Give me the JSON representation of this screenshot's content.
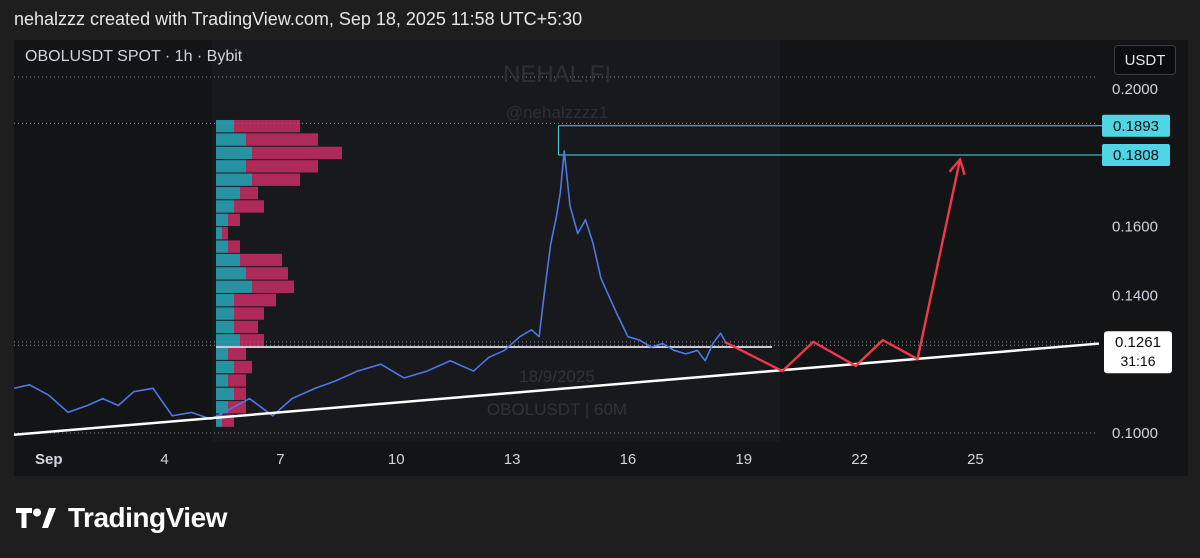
{
  "header": {
    "text": "nehalzzz created with TradingView.com, Sep 18, 2025 11:58 UTC+5:30"
  },
  "chart": {
    "symbol_line": "OBOLUSDT SPOT · 1h · Bybit",
    "currency": "USDT",
    "watermark_title": "NEHAL.FI",
    "watermark_handle": "@nehalzzzz1",
    "center_watermark_date": "18/9/2025",
    "center_watermark_symbol": "OBOLUSDT | 60M"
  },
  "chart_data": {
    "type": "line",
    "title": "OBOLUSDT SPOT · 1h · Bybit",
    "y_axis": {
      "ticks": [
        0.2,
        0.16,
        0.14,
        0.1
      ],
      "tick_labels": [
        "0.2000",
        "0.1600",
        "0.1400",
        "0.1000"
      ],
      "range": [
        0.0995,
        0.2035
      ]
    },
    "x_axis": {
      "day_range": [
        0.1,
        28.2
      ],
      "ticks": [
        1,
        4,
        7,
        10,
        13,
        16,
        19,
        22,
        25
      ],
      "tick_labels": [
        "Sep",
        "4",
        "7",
        "10",
        "13",
        "16",
        "19",
        "22",
        "25"
      ]
    },
    "price_series": {
      "x": [
        0.1,
        0.5,
        1.0,
        1.5,
        2.0,
        2.4,
        2.8,
        3.2,
        3.7,
        4.2,
        4.7,
        5.2,
        5.7,
        6.2,
        6.8,
        7.3,
        7.9,
        8.4,
        9.0,
        9.6,
        10.2,
        10.8,
        11.4,
        12.0,
        12.4,
        12.8,
        13.2,
        13.5,
        13.7,
        13.85,
        14.0,
        14.15,
        14.25,
        14.35,
        14.5,
        14.7,
        14.9,
        15.1,
        15.3,
        15.5,
        15.7,
        16.0,
        16.3,
        16.6,
        16.9,
        17.2,
        17.5,
        17.8,
        18.0,
        18.2,
        18.4,
        18.55
      ],
      "y": [
        0.113,
        0.114,
        0.111,
        0.106,
        0.108,
        0.11,
        0.108,
        0.112,
        0.113,
        0.105,
        0.106,
        0.104,
        0.107,
        0.11,
        0.105,
        0.11,
        0.113,
        0.115,
        0.118,
        0.12,
        0.116,
        0.118,
        0.121,
        0.118,
        0.122,
        0.124,
        0.128,
        0.13,
        0.128,
        0.142,
        0.155,
        0.163,
        0.17,
        0.182,
        0.166,
        0.158,
        0.162,
        0.155,
        0.145,
        0.14,
        0.135,
        0.128,
        0.127,
        0.125,
        0.126,
        0.124,
        0.123,
        0.124,
        0.121,
        0.126,
        0.129,
        0.126
      ]
    },
    "projection": {
      "x": [
        18.5,
        20.0,
        20.8,
        21.9,
        22.6,
        23.5,
        24.6
      ],
      "y": [
        0.1265,
        0.118,
        0.1265,
        0.1195,
        0.127,
        0.1215,
        0.1795
      ]
    },
    "support_trendline": {
      "x": [
        0.1,
        28.2
      ],
      "y": [
        0.0995,
        0.126
      ]
    },
    "horizontal_levels": [
      {
        "value": 0.1893,
        "label": "0.1893",
        "color": "#4fd6e6",
        "from_day": 14.2
      },
      {
        "value": 0.1808,
        "label": "0.1808",
        "color": "#4fd6e6",
        "from_day": 14.2
      }
    ],
    "dotted_levels": [
      0.2035,
      0.19,
      0.1265,
      0.1255,
      0.1
    ],
    "point_of_control": 0.125,
    "current_price": {
      "value": 0.1261,
      "label": "0.1261",
      "countdown": "31:16"
    },
    "volume_profile": {
      "price_low": 0.1015,
      "price_high": 0.191,
      "row_count": 23,
      "buy": [
        1,
        2,
        3,
        2,
        3,
        2,
        4,
        3,
        3,
        3,
        6,
        5,
        4,
        2,
        1,
        2,
        3,
        4,
        6,
        5,
        6,
        5,
        3
      ],
      "sell": [
        2,
        3,
        2,
        3,
        3,
        3,
        4,
        4,
        5,
        7,
        7,
        7,
        7,
        2,
        1,
        2,
        5,
        3,
        8,
        12,
        15,
        12,
        11
      ],
      "buy_color": "#2aa8b8",
      "sell_color": "#e0306e"
    },
    "colors": {
      "price": "#4d78e6",
      "projection": "#f0384c",
      "trendline": "#ffffff",
      "poc": "#c8cbd4"
    }
  },
  "footer": {
    "brand": "TradingView"
  }
}
